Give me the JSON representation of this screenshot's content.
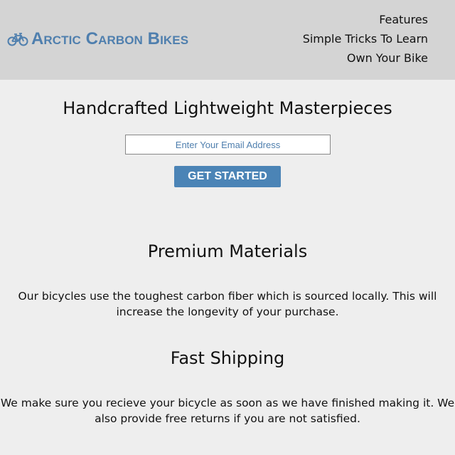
{
  "header": {
    "brand": "Arctic Carbon Bikes",
    "logo_icon": "bicycle-icon",
    "nav": [
      {
        "label": "Features"
      },
      {
        "label": "Simple Tricks To Learn"
      },
      {
        "label": "Own Your Bike"
      }
    ]
  },
  "hero": {
    "title": "Handcrafted Lightweight Masterpieces",
    "email_placeholder": "Enter Your Email Address",
    "cta_label": "GET STARTED"
  },
  "features": [
    {
      "title": "Premium Materials",
      "text": "Our bicycles use the toughest carbon fiber which is sourced locally. This will increase the longevity of your purchase."
    },
    {
      "title": "Fast Shipping",
      "text": "We make sure you recieve your bicycle as soon as we have finished making it. We also provide free returns if you are not satisfied."
    }
  ],
  "colors": {
    "header_bg": "#d4d4d4",
    "page_bg": "#eeeeee",
    "brand": "#4f7fae",
    "button": "#4b84b6"
  }
}
